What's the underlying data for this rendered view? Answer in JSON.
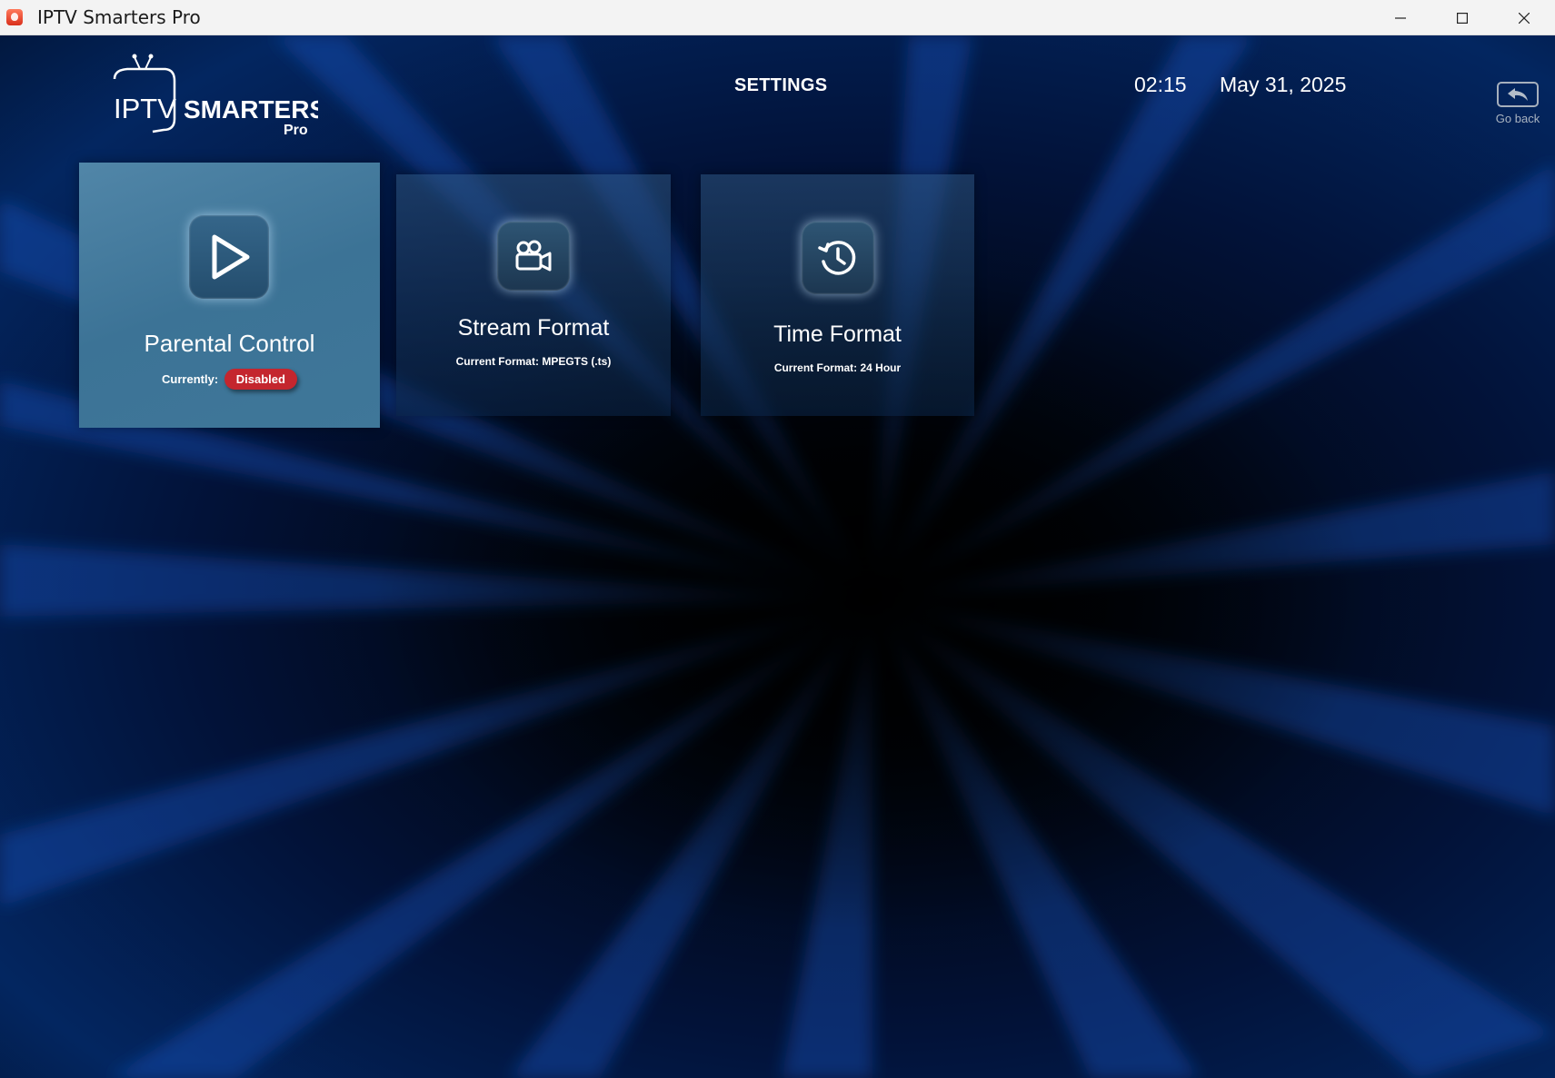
{
  "window": {
    "title": "IPTV Smarters Pro",
    "controls": [
      "minimize-icon",
      "maximize-icon",
      "close-icon"
    ]
  },
  "header": {
    "logo": {
      "main": "IPTV",
      "brand": "SMARTERS",
      "suffix": "Pro"
    },
    "title": "SETTINGS",
    "time": "02:15",
    "date": "May 31, 2025",
    "go_back_label": "Go back"
  },
  "cards": [
    {
      "title": "Parental Control",
      "icon": "play-icon",
      "status_label": "Currently:",
      "status_value": "Disabled",
      "status_color": "#c4262e"
    },
    {
      "title": "Stream Format",
      "icon": "video-camera-icon",
      "format_label": "Current Format:",
      "format_value": "MPEGTS (.ts)"
    },
    {
      "title": "Time Format",
      "icon": "clock-history-icon",
      "format_label": "Current Format:",
      "format_value": "24 Hour"
    }
  ],
  "colors": {
    "active_card": "#3f7799",
    "badge_disabled": "#c4262e",
    "background": "#021238"
  }
}
